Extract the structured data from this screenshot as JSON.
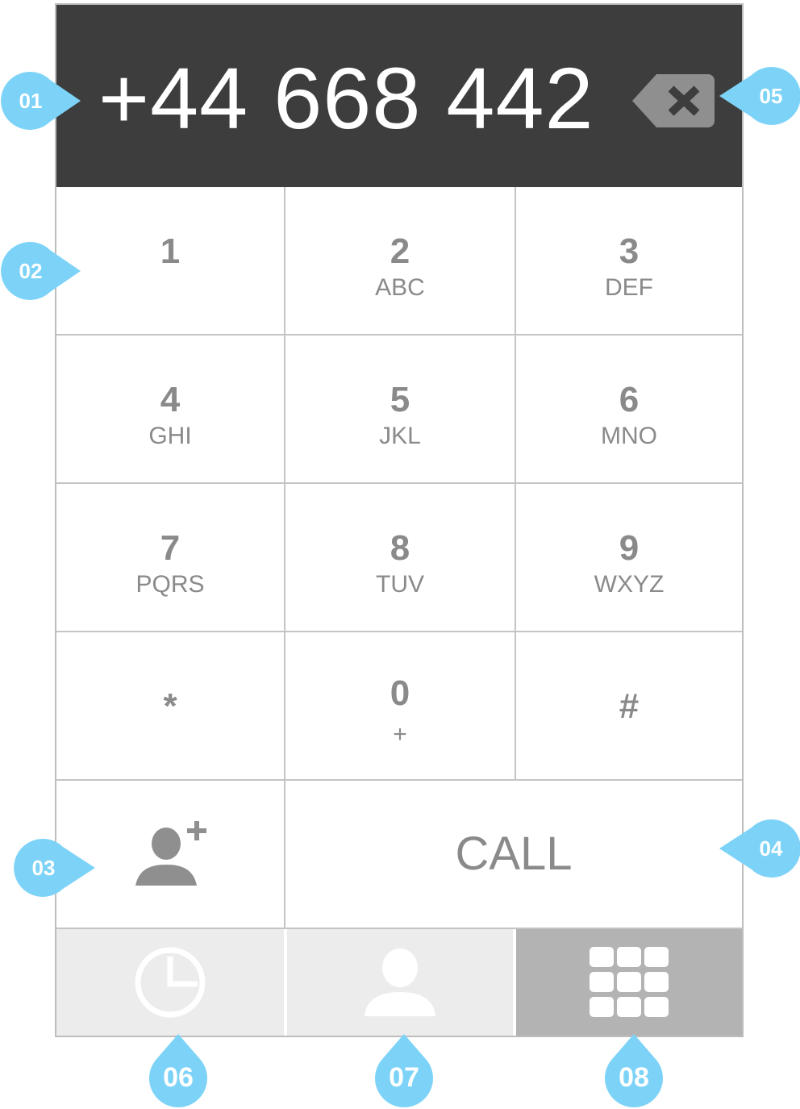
{
  "display": {
    "number": "+44 668 442"
  },
  "keypad": {
    "keys": [
      {
        "digit": "1",
        "letters": ""
      },
      {
        "digit": "2",
        "letters": "ABC"
      },
      {
        "digit": "3",
        "letters": "DEF"
      },
      {
        "digit": "4",
        "letters": "GHI"
      },
      {
        "digit": "5",
        "letters": "JKL"
      },
      {
        "digit": "6",
        "letters": "MNO"
      },
      {
        "digit": "7",
        "letters": "PQRS"
      },
      {
        "digit": "8",
        "letters": "TUV"
      },
      {
        "digit": "9",
        "letters": "WXYZ"
      },
      {
        "digit": "*",
        "letters": ""
      },
      {
        "digit": "0",
        "letters": "+"
      },
      {
        "digit": "#",
        "letters": ""
      }
    ]
  },
  "actions": {
    "call_label": "CALL",
    "add_contact_icon": "add-contact-icon"
  },
  "tabs": {
    "recents_icon": "clock-icon",
    "contacts_icon": "person-icon",
    "keypad_icon": "grid-icon"
  },
  "markers": {
    "m01": "01",
    "m02": "02",
    "m03": "03",
    "m04": "04",
    "m05": "05",
    "m06": "06",
    "m07": "07",
    "m08": "08"
  },
  "colors": {
    "display_bg": "#3d3d3d",
    "key_text": "#8a8a8a",
    "marker": "#7dd3f7",
    "tab_bg": "#ececec",
    "tab_active_bg": "#b3b3b3"
  }
}
